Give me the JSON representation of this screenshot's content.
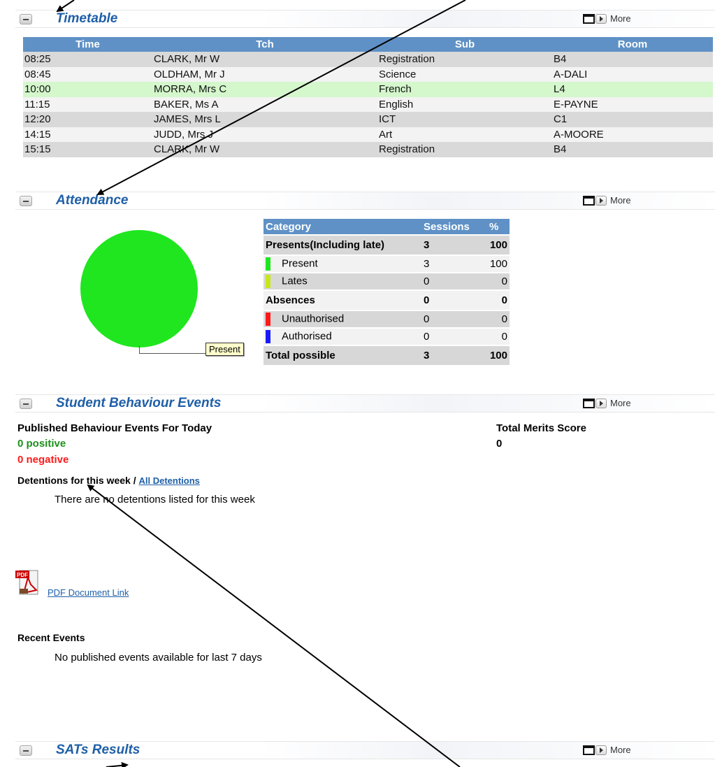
{
  "panels": {
    "timetable": {
      "title": "Timetable",
      "more": "More"
    },
    "attendance": {
      "title": "Attendance",
      "more": "More"
    },
    "behaviour": {
      "title": "Student Behaviour Events",
      "more": "More"
    },
    "sats": {
      "title": "SATs Results",
      "more": "More"
    }
  },
  "timetable": {
    "headers": [
      "Time",
      "Tch",
      "Sub",
      "Room"
    ],
    "rows": [
      [
        "08:25",
        "CLARK, Mr W",
        "Registration",
        "B4"
      ],
      [
        "08:45",
        "OLDHAM, Mr J",
        "Science",
        "A-DALI"
      ],
      [
        "10:00",
        "MORRA, Mrs C",
        "French",
        "L4"
      ],
      [
        "11:15",
        "BAKER, Ms A",
        "English",
        "E-PAYNE"
      ],
      [
        "12:20",
        "JAMES, Mrs L",
        "ICT",
        "C1"
      ],
      [
        "14:15",
        "JUDD, Mrs J",
        "Art",
        "A-MOORE"
      ],
      [
        "15:15",
        "CLARK, Mr W",
        "Registration",
        "B4"
      ]
    ],
    "current_row_index": 2
  },
  "attendance": {
    "headers": [
      "Category",
      "Sessions",
      "%"
    ],
    "rows": [
      [
        "Presents(Including late)",
        "3",
        "100"
      ],
      [
        "Present",
        "3",
        "100"
      ],
      [
        "Lates",
        "0",
        "0"
      ],
      [
        "Absences",
        "0",
        "0"
      ],
      [
        "Unauthorised",
        "0",
        "0"
      ],
      [
        "Authorised",
        "0",
        "0"
      ],
      [
        "Total possible",
        "3",
        "100"
      ]
    ],
    "swatch_colors": {
      "present": "#1fe61f",
      "lates": "#c8e61a",
      "unauthorised": "#ff1a1a",
      "authorised": "#1a1aff"
    },
    "pie_label": "Present"
  },
  "behaviour": {
    "published_heading": "Published Behaviour Events For Today",
    "positive": "0 positive",
    "negative": "0 negative",
    "merits_heading": "Total Merits Score",
    "merits_value": "0",
    "detentions_heading": "Detentions for this week /",
    "all_detentions_link": "All Detentions",
    "no_detentions": "There are no detentions listed for this week",
    "pdf_link": "PDF Document Link",
    "recent_heading": "Recent Events",
    "no_recent": "No published events available for last 7 days"
  },
  "colors": {
    "header_blue": "#5f91c6",
    "title_blue": "#1f5fa7",
    "positive_green": "#1d8f1d",
    "negative_red": "#ff1a1a"
  }
}
